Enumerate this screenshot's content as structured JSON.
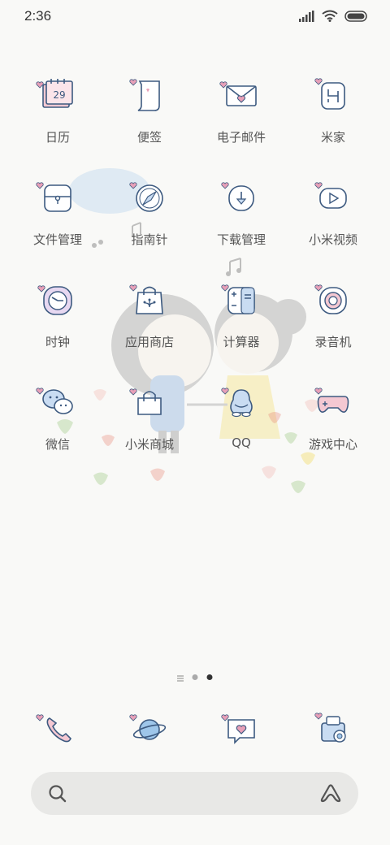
{
  "status": {
    "time": "2:36"
  },
  "apps": [
    {
      "name": "calendar",
      "label": "日历",
      "icon": "calendar-icon",
      "date": "29"
    },
    {
      "name": "notes",
      "label": "便签",
      "icon": "notes-icon"
    },
    {
      "name": "email",
      "label": "电子邮件",
      "icon": "mail-icon"
    },
    {
      "name": "mihome",
      "label": "米家",
      "icon": "mihome-icon"
    },
    {
      "name": "file-manager",
      "label": "文件管理",
      "icon": "file-manager-icon"
    },
    {
      "name": "compass",
      "label": "指南针",
      "icon": "compass-icon"
    },
    {
      "name": "downloads",
      "label": "下载管理",
      "icon": "download-icon"
    },
    {
      "name": "mi-video",
      "label": "小米视频",
      "icon": "video-icon"
    },
    {
      "name": "clock",
      "label": "时钟",
      "icon": "clock-icon"
    },
    {
      "name": "app-store",
      "label": "应用商店",
      "icon": "app-store-icon"
    },
    {
      "name": "calculator",
      "label": "计算器",
      "icon": "calculator-icon"
    },
    {
      "name": "recorder",
      "label": "录音机",
      "icon": "recorder-icon"
    },
    {
      "name": "wechat",
      "label": "微信",
      "icon": "wechat-icon"
    },
    {
      "name": "mi-store",
      "label": "小米商城",
      "icon": "shopping-bag-icon"
    },
    {
      "name": "qq",
      "label": "QQ",
      "icon": "qq-penguin-icon"
    },
    {
      "name": "game-center",
      "label": "游戏中心",
      "icon": "gamepad-icon"
    }
  ],
  "dock": [
    {
      "name": "phone",
      "icon": "phone-icon"
    },
    {
      "name": "browser",
      "icon": "planet-icon"
    },
    {
      "name": "messages",
      "icon": "message-heart-icon"
    },
    {
      "name": "camera",
      "icon": "camera-icon"
    }
  ],
  "pager": {
    "pages": 2,
    "active": 2
  },
  "colors": {
    "background": "#f9f9f7",
    "icon_stroke": "#3d5a80",
    "heart": "#e8a0b8",
    "search_bg": "#e8e8e6"
  }
}
